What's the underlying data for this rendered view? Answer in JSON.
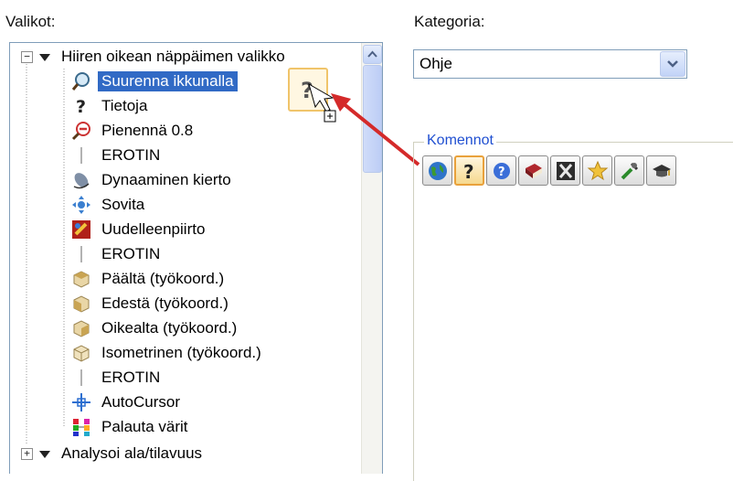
{
  "left_panel": {
    "title": "Valikot:",
    "tree": [
      {
        "label": "Hiiren oikean näppäimen valikko",
        "icon": "menu-icon",
        "level": 0,
        "expander": "−"
      },
      {
        "label": "Suurenna ikkunalla",
        "icon": "zoom-window-icon",
        "level": 1,
        "selected": true
      },
      {
        "label": "Tietoja",
        "icon": "help-icon",
        "level": 1
      },
      {
        "label": "Pienennä 0.8",
        "icon": "zoom-out-icon",
        "level": 1
      },
      {
        "label": "EROTIN",
        "icon": "separator-icon",
        "level": 1
      },
      {
        "label": "Dynaaminen kierto",
        "icon": "rotate-icon",
        "level": 1
      },
      {
        "label": "Sovita",
        "icon": "fit-icon",
        "level": 1
      },
      {
        "label": "Uudelleenpiirto",
        "icon": "redraw-icon",
        "level": 1
      },
      {
        "label": "EROTIN",
        "icon": "separator-icon",
        "level": 1
      },
      {
        "label": "Päältä (työkoord.)",
        "icon": "view-top-icon",
        "level": 1
      },
      {
        "label": "Edestä (työkoord.)",
        "icon": "view-front-icon",
        "level": 1
      },
      {
        "label": "Oikealta (työkoord.)",
        "icon": "view-right-icon",
        "level": 1
      },
      {
        "label": "Isometrinen (työkoord.)",
        "icon": "view-iso-icon",
        "level": 1
      },
      {
        "label": "EROTIN",
        "icon": "separator-icon",
        "level": 1
      },
      {
        "label": "AutoCursor",
        "icon": "cursor-icon",
        "level": 1
      },
      {
        "label": "Palauta värit",
        "icon": "colors-icon",
        "level": 1
      },
      {
        "label": "Analysoi ala/tilavuus",
        "icon": "menu-icon",
        "level": 0,
        "expander": "+"
      }
    ]
  },
  "right_panel": {
    "category_label": "Kategoria:",
    "category_value": "Ohje",
    "commands_group_title": "Komennot",
    "commands": [
      {
        "icon": "globe-icon"
      },
      {
        "icon": "help-icon",
        "active": true
      },
      {
        "icon": "info-icon"
      },
      {
        "icon": "book-icon"
      },
      {
        "icon": "x-icon"
      },
      {
        "icon": "star-icon"
      },
      {
        "icon": "tools-icon"
      },
      {
        "icon": "graduation-cap-icon"
      }
    ]
  },
  "colors": {
    "selection": "#316ac5",
    "group_title": "#1f4fd1",
    "arrow": "#d42a2a",
    "active_border": "#e9a13b"
  }
}
